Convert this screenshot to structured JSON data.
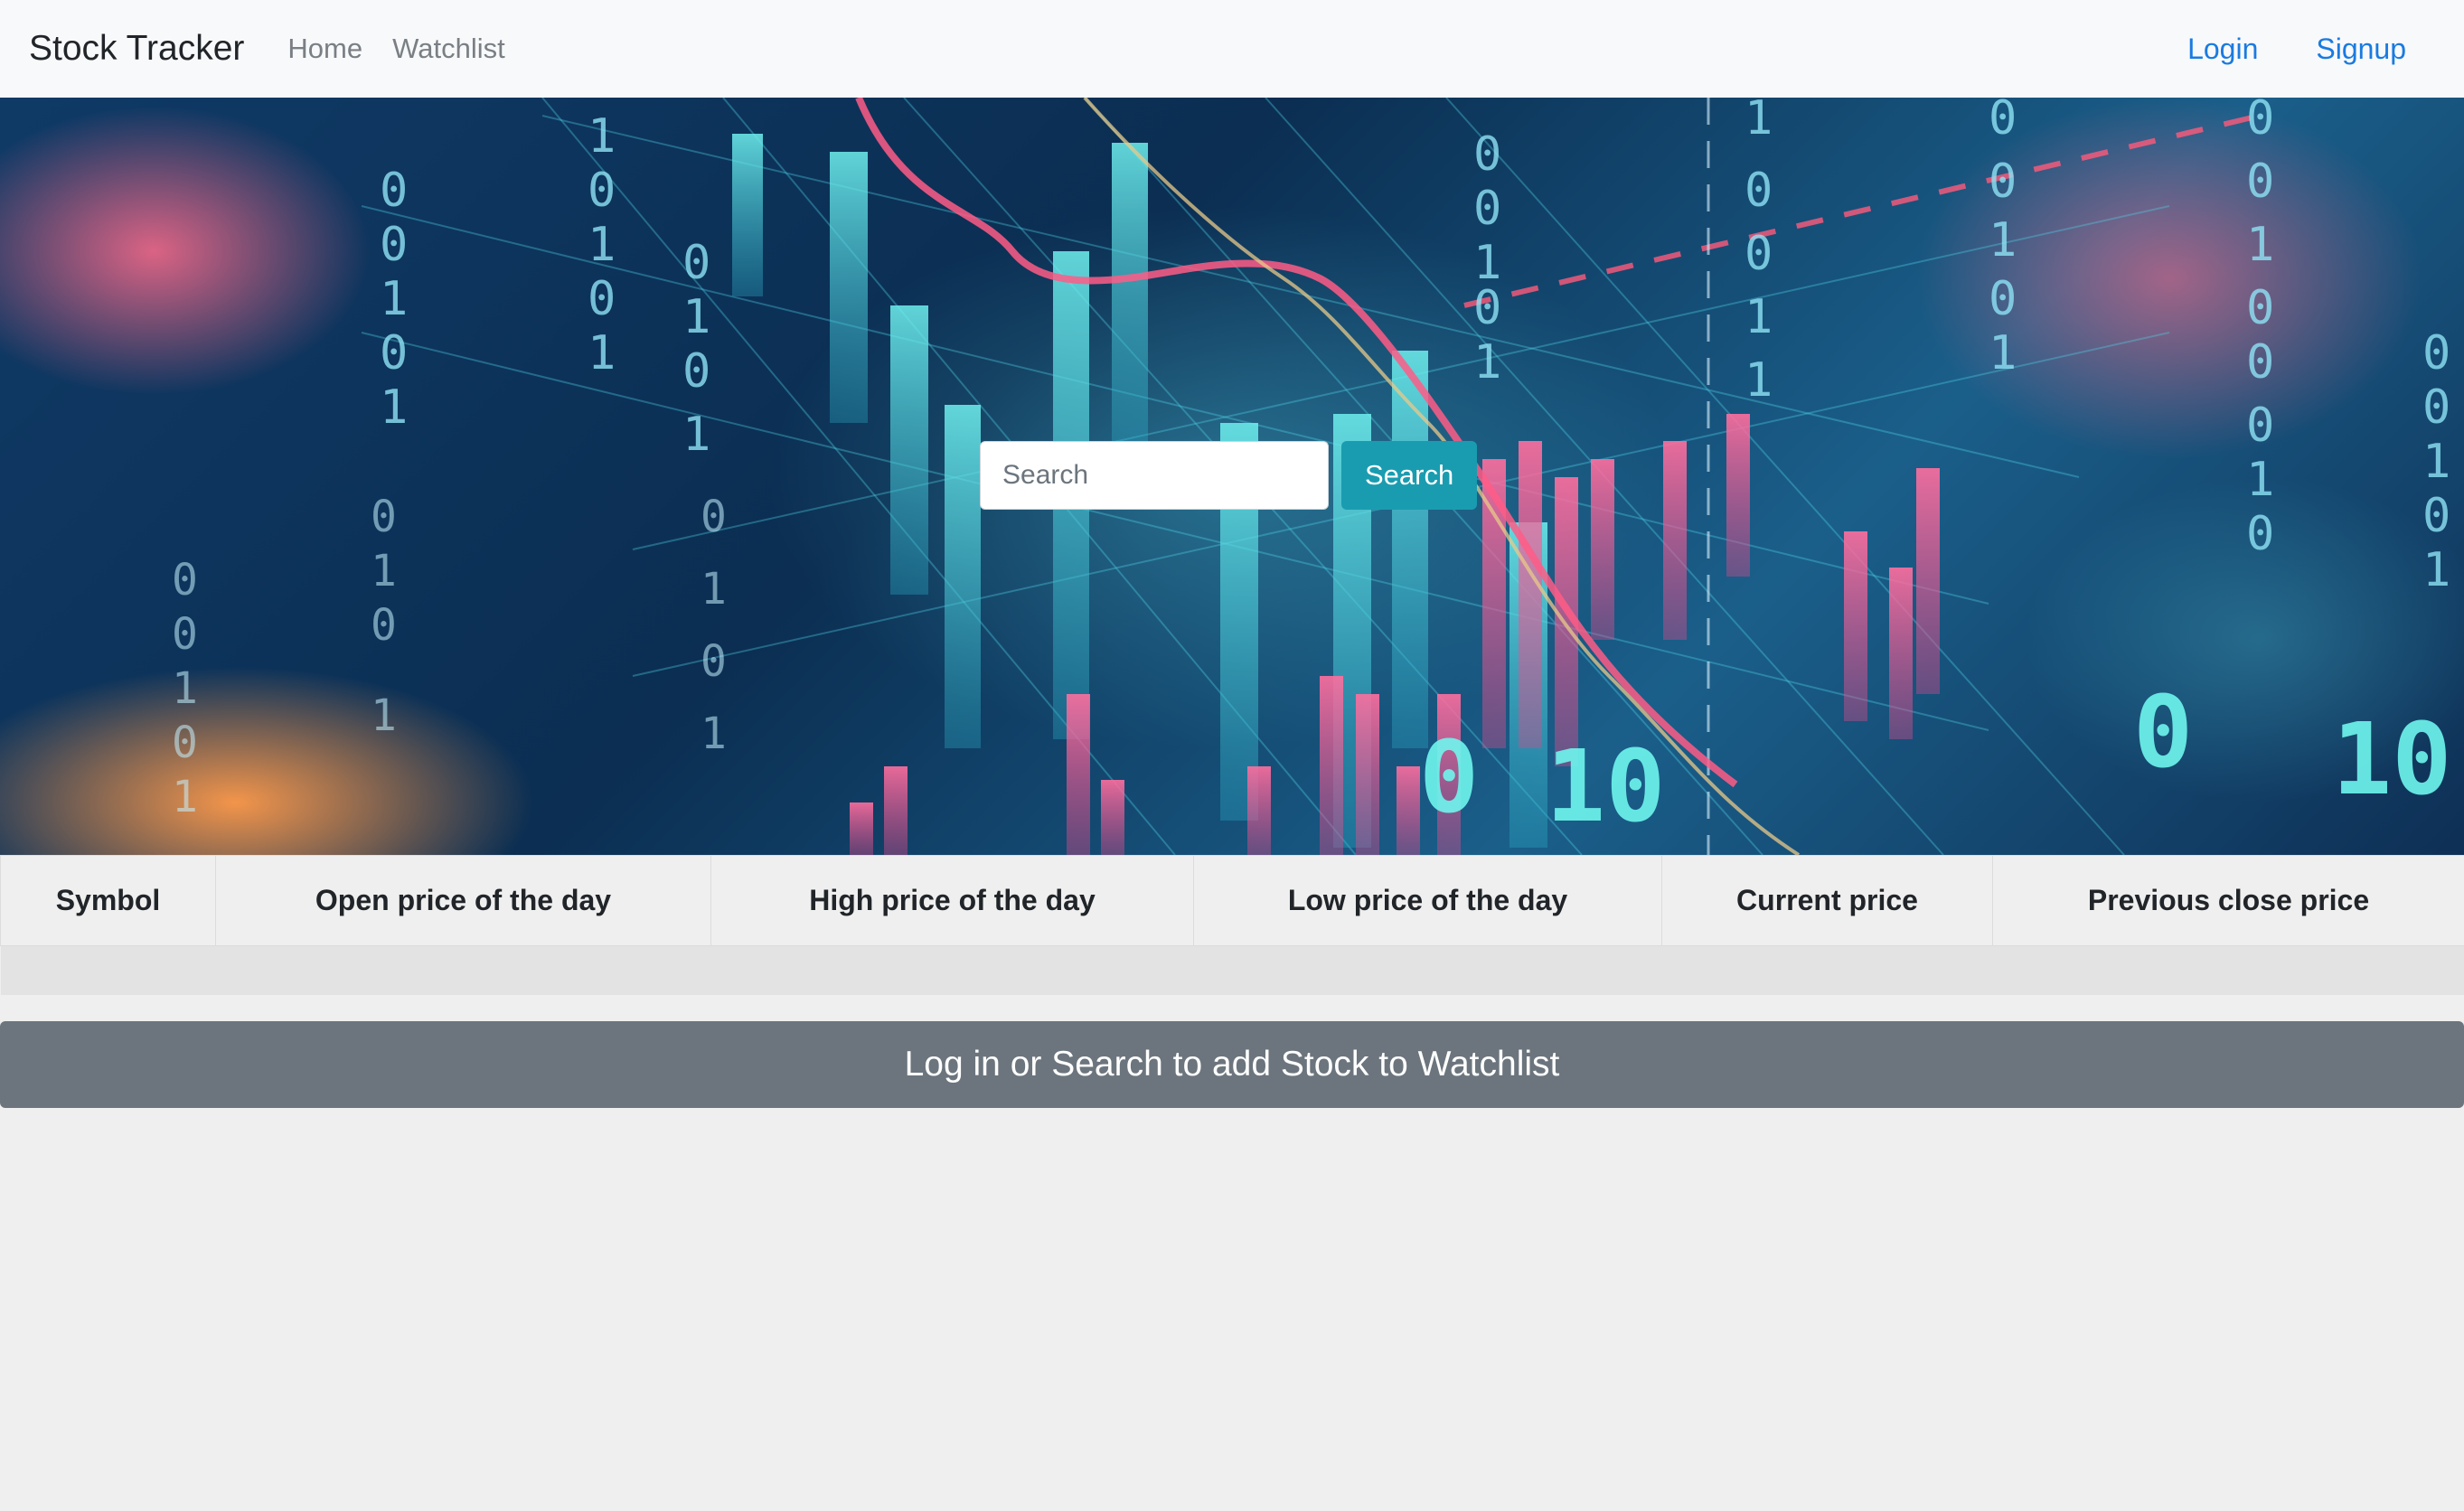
{
  "navbar": {
    "brand": "Stock Tracker",
    "links": [
      {
        "label": "Home"
      },
      {
        "label": "Watchlist"
      }
    ],
    "auth": {
      "login": "Login",
      "signup": "Signup"
    }
  },
  "hero": {
    "search": {
      "placeholder": "Search",
      "button_label": "Search"
    }
  },
  "table": {
    "columns": [
      "Symbol",
      "Open price of the day",
      "High price of the day",
      "Low price of the day",
      "Current price",
      "Previous close price"
    ],
    "rows": []
  },
  "watchlist_banner": "Log in or Search to add Stock to Watchlist",
  "colors": {
    "navbar_bg": "#f8f9fa",
    "link_primary": "#1a7be0",
    "search_button": "#1a9cb0",
    "banner_bg": "#6c757d"
  }
}
